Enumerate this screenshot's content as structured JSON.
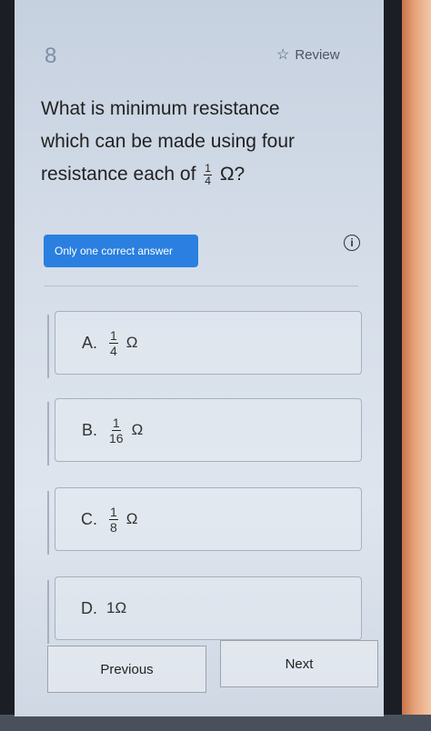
{
  "question": {
    "number": "8",
    "review_label": "Review",
    "text_line1": "What is minimum resistance",
    "text_line2": "which can be made using four",
    "text_line3_prefix": "resistance each of",
    "fraction": {
      "numerator": "1",
      "denominator": "4"
    },
    "text_line3_suffix": "Ω?"
  },
  "answer_type": "Only one correct answer",
  "options": [
    {
      "letter": "A.",
      "numerator": "1",
      "denominator": "4",
      "unit": "Ω"
    },
    {
      "letter": "B.",
      "numerator": "1",
      "denominator": "16",
      "unit": "Ω"
    },
    {
      "letter": "C.",
      "numerator": "1",
      "denominator": "8",
      "unit": "Ω"
    },
    {
      "letter": "D.",
      "value": "1Ω"
    }
  ],
  "nav": {
    "previous": "Previous",
    "next": "Next"
  }
}
